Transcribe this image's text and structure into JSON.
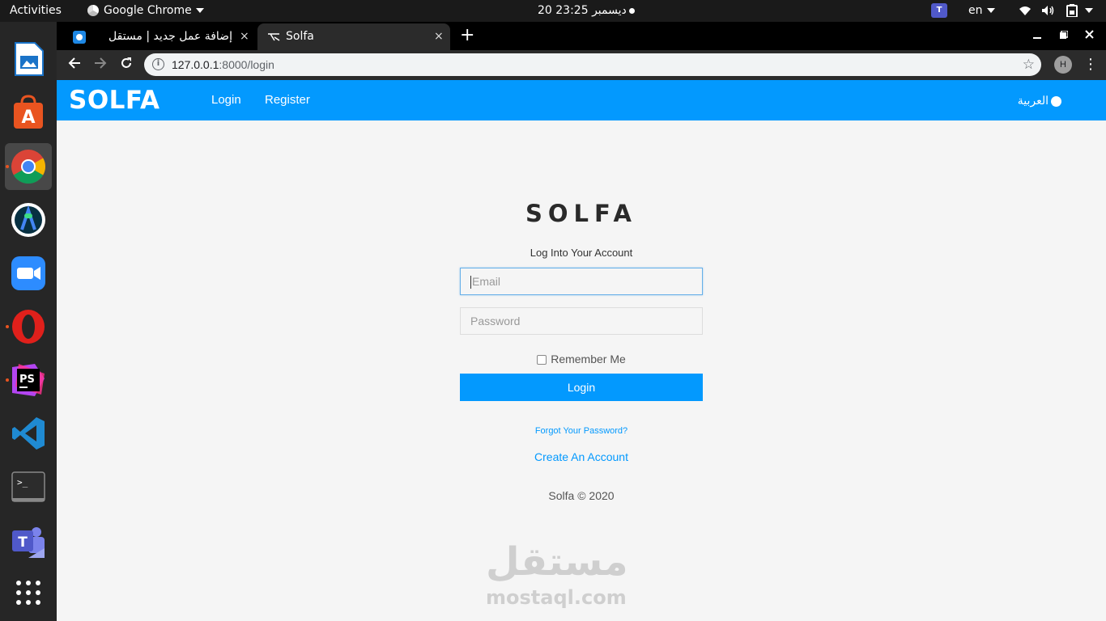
{
  "system_bar": {
    "activities": "Activities",
    "app_menu": "Google Chrome",
    "clock": "20 ديسمبر  23:25",
    "keyboard_layout": "en",
    "teams_tray_letter": "T"
  },
  "dock": {
    "apps": [
      {
        "name": "libreoffice-impress-icon",
        "color": "#1a73c8"
      },
      {
        "name": "software-center-icon",
        "color": "#e95420",
        "glyph": "A"
      },
      {
        "name": "chrome-icon",
        "color": "#4285f4"
      },
      {
        "name": "android-studio-icon",
        "color": "#3ddc84"
      },
      {
        "name": "zoom-icon",
        "color": "#2d8cff"
      },
      {
        "name": "opera-icon",
        "color": "#e0201b"
      },
      {
        "name": "phpstorm-icon",
        "color": "#b345f1",
        "glyph": "PS"
      },
      {
        "name": "vscode-icon",
        "color": "#1f8ad2"
      },
      {
        "name": "terminal-icon",
        "color": "#333333",
        "glyph": ">_"
      },
      {
        "name": "teams-icon",
        "color": "#5059c9",
        "glyph": "T"
      },
      {
        "name": "show-apps-icon",
        "color": "#ffffff"
      }
    ]
  },
  "browser": {
    "tabs": [
      {
        "title": "إضافة عمل جديد | مستقل",
        "close": "×"
      },
      {
        "title": "Solfa",
        "close": "×"
      }
    ],
    "new_tab": "+",
    "address": {
      "host": "127.0.0.1",
      "rest": ":8000/login"
    },
    "profile_initial": "H"
  },
  "site": {
    "brand": "SOLFA",
    "nav": {
      "login": "Login",
      "register": "Register"
    },
    "language": "العربية",
    "colors": {
      "primary": "#0399fe"
    }
  },
  "login_form": {
    "logo": "SOLFA",
    "subtitle": "Log Into Your Account",
    "email_placeholder": "Email",
    "password_placeholder": "Password",
    "remember_label": "Remember Me",
    "submit_label": "Login",
    "forgot_link": "Forgot Your Password?",
    "create_account_link": "Create An Account",
    "copyright": "Solfa © 2020"
  },
  "watermark": {
    "arabic": "مستقل",
    "latin": "mostaql.com"
  }
}
